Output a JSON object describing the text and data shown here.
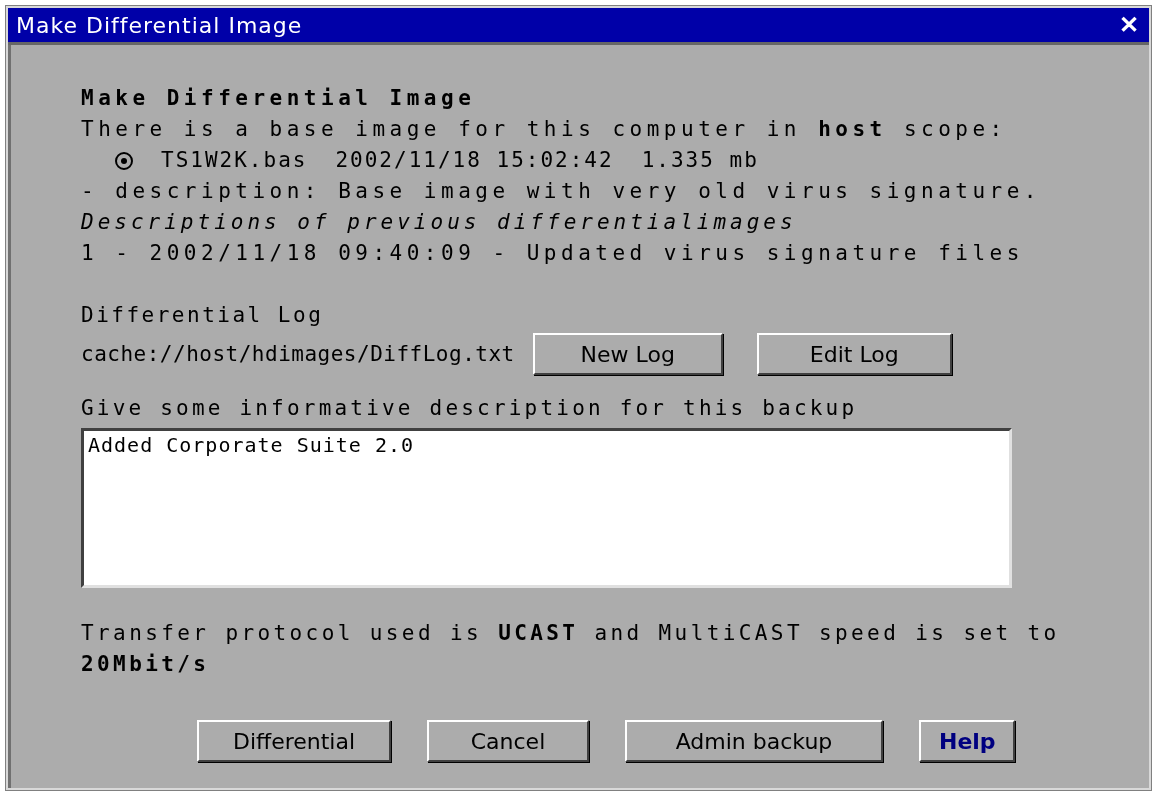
{
  "window": {
    "title": "Make Differential Image",
    "close": "✕"
  },
  "heading": "Make Differential Image",
  "base_intro": "There is a base image for this computer in **host** scope:",
  "base_image": {
    "selected": true,
    "file": "TS1W2K.bas",
    "date": "2002/11/18 15:02:42",
    "size": "1.335 mb"
  },
  "base_description": "- description: Base image with very old virus signature.",
  "previous_heading": "Descriptions of previous differentialimages",
  "previous": [
    "1 - 2002/11/18 09:40:09 - Updated virus signature files"
  ],
  "log": {
    "label": "Differential Log",
    "path": "cache://host/hdimages/DiffLog.txt",
    "buttons": [
      "New Log",
      "Edit Log"
    ]
  },
  "description": {
    "label": "Give some informative description for this backup",
    "value": "Added Corporate Suite 2.0"
  },
  "transfer": "Transfer protocol used is **UCAST** and MultiCAST speed is set to **20Mbit/s**",
  "buttons": [
    {
      "label": "Differential",
      "kind": "normal"
    },
    {
      "label": "Cancel",
      "kind": "normal"
    },
    {
      "label": "Admin backup",
      "kind": "normal"
    },
    {
      "label": "Help",
      "kind": "help"
    }
  ]
}
